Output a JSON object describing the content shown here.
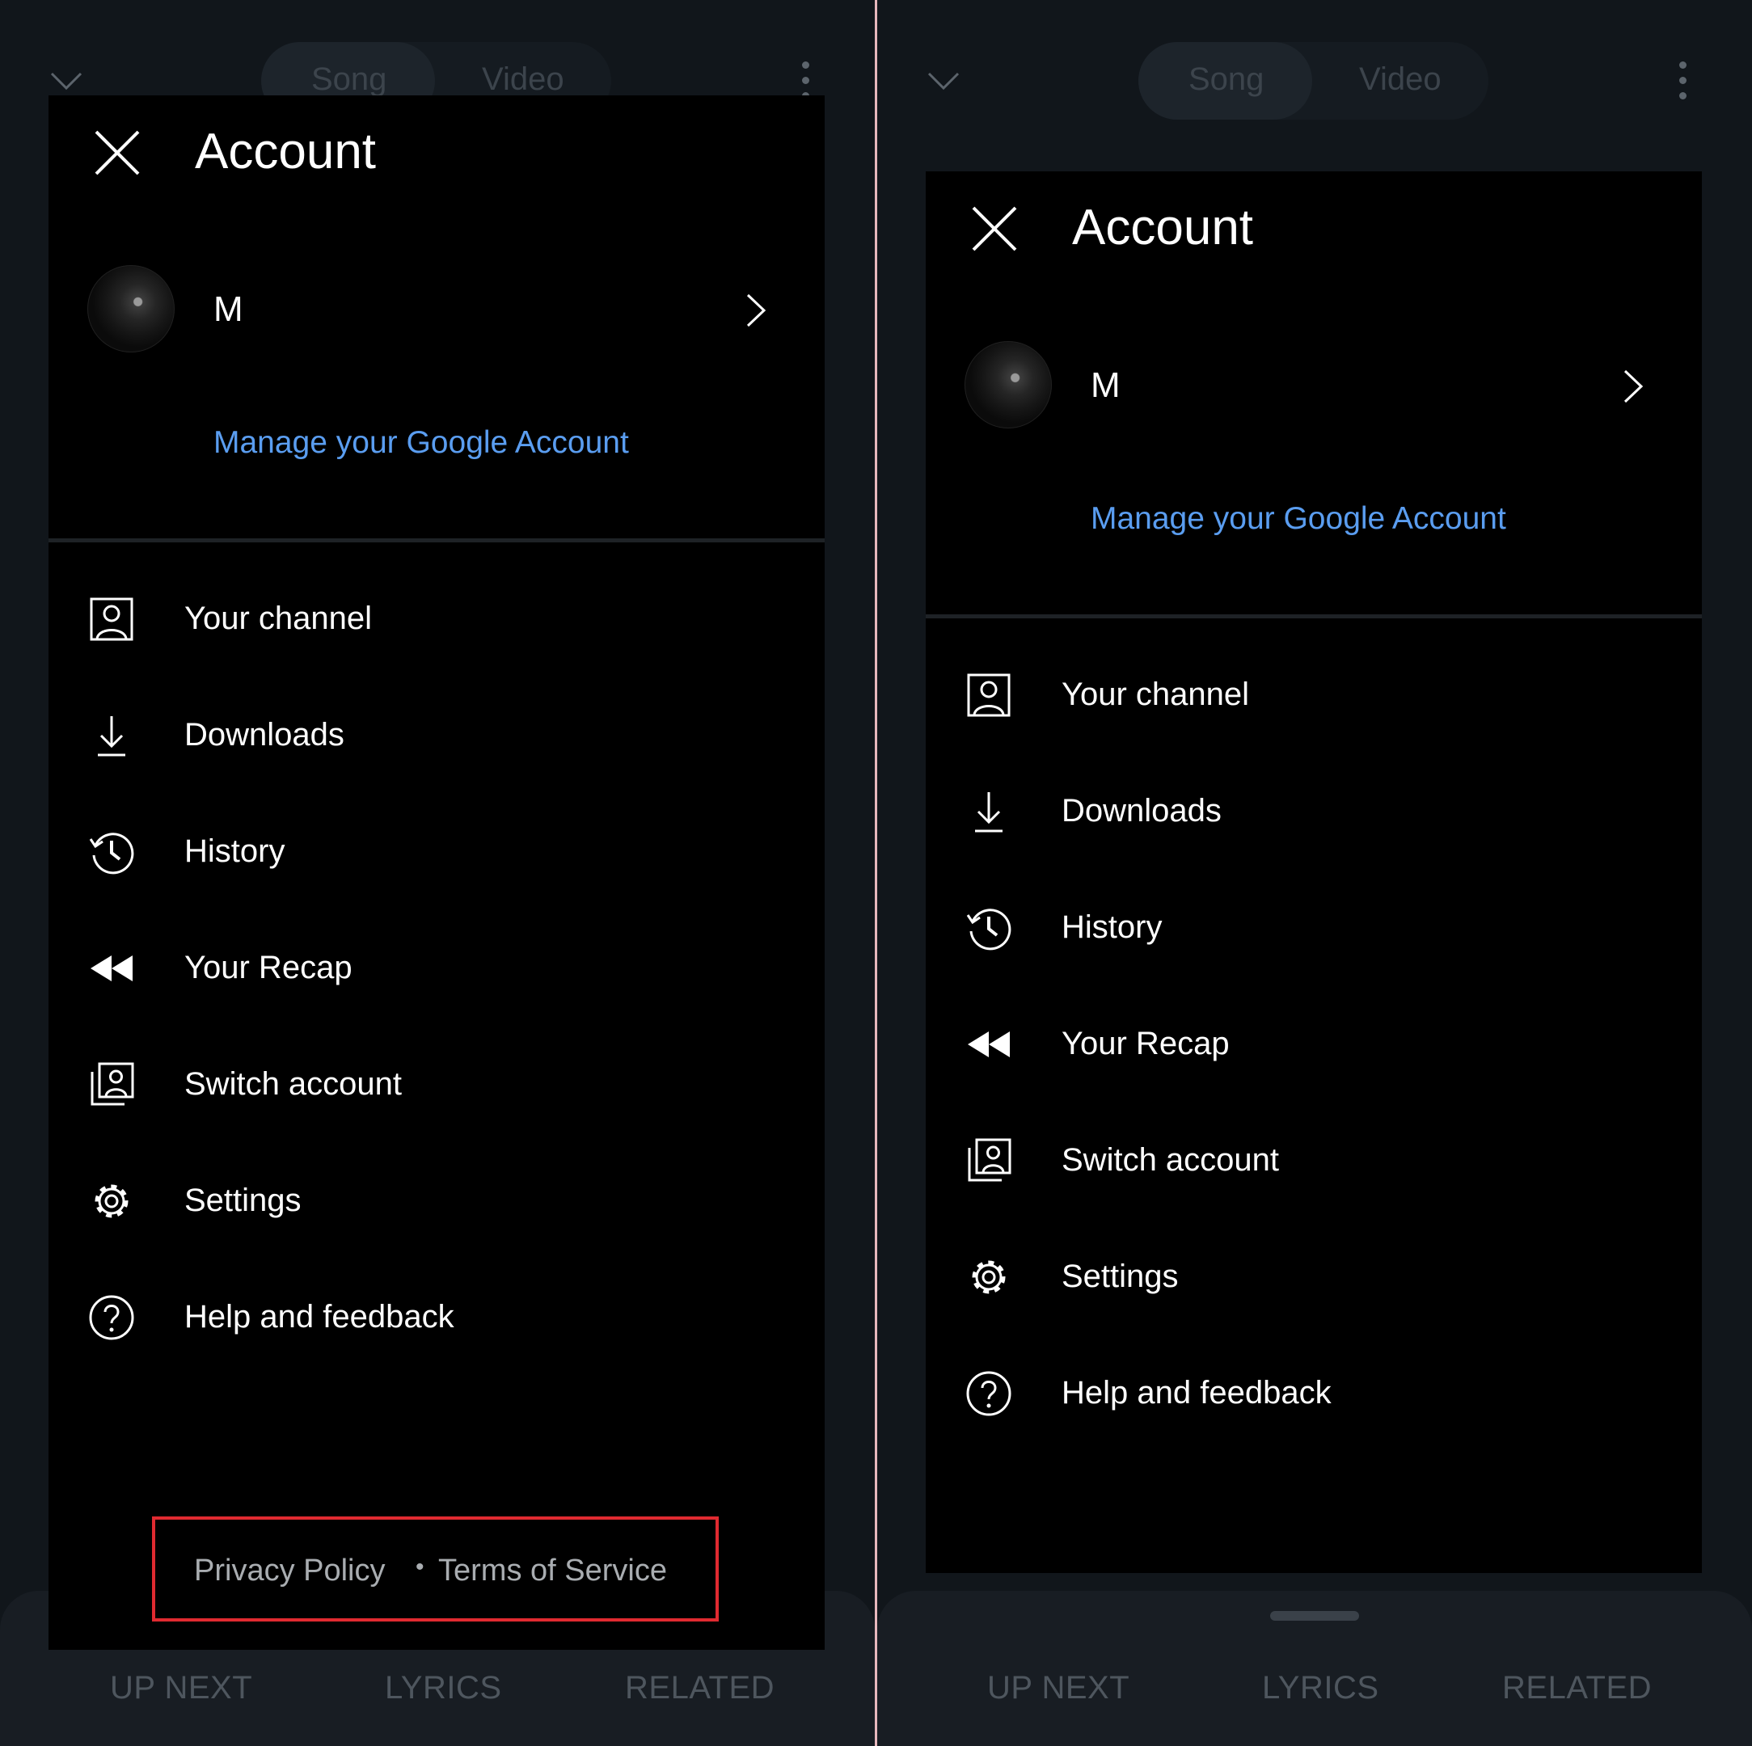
{
  "player": {
    "tabs": [
      "Song",
      "Video"
    ],
    "bottom_tabs": [
      "UP NEXT",
      "LYRICS",
      "RELATED"
    ]
  },
  "account": {
    "title": "Account",
    "name": "M",
    "manage_link": "Manage your Google Account",
    "menu": [
      {
        "label": "Your channel",
        "icon": "person-box-icon"
      },
      {
        "label": "Downloads",
        "icon": "download-icon"
      },
      {
        "label": "History",
        "icon": "history-icon"
      },
      {
        "label": "Your Recap",
        "icon": "rewind-icon"
      },
      {
        "label": "Switch account",
        "icon": "switch-account-icon"
      },
      {
        "label": "Settings",
        "icon": "gear-icon"
      },
      {
        "label": "Help and feedback",
        "icon": "help-icon"
      }
    ],
    "footer": {
      "privacy": "Privacy Policy",
      "separator": "•",
      "terms": "Terms of Service"
    }
  },
  "colors": {
    "link": "#5a9df0",
    "highlight_box": "#e02a30",
    "panel_bg": "#000000",
    "screen_bg": "#11161b"
  }
}
